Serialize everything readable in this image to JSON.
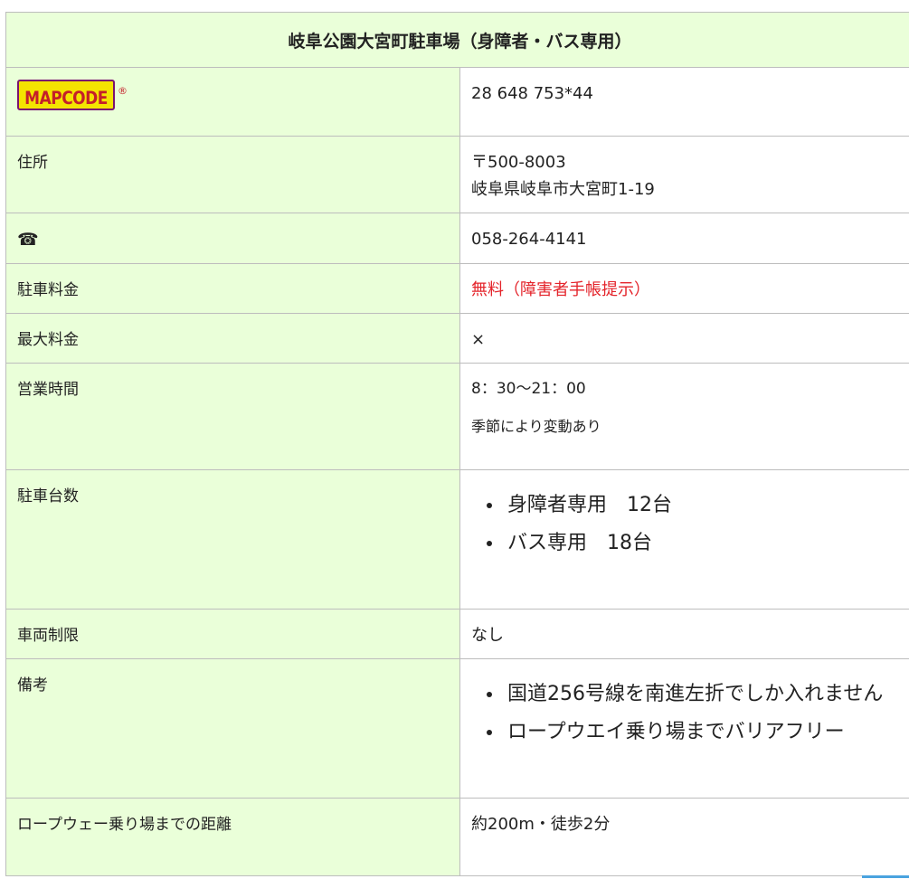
{
  "title": "岐阜公園大宮町駐車場（身障者・バス専用）",
  "mapcode": {
    "logo_text": "MAPCODE",
    "registered_mark": "®",
    "value": "28 648 753*44"
  },
  "address": {
    "label": "住所",
    "postal": "〒500-8003",
    "line": "岐阜県岐阜市大宮町1-19"
  },
  "phone": {
    "icon": "telephone-icon",
    "glyph": "☎",
    "value": "058-264-4141"
  },
  "fee": {
    "label": "駐車料金",
    "value": "無料（障害者手帳提示）",
    "color": "#e4242b"
  },
  "max_fee": {
    "label": "最大料金",
    "value": "×"
  },
  "hours": {
    "label": "営業時間",
    "value": "8：30〜21：00",
    "note": "季節により変動あり"
  },
  "spaces": {
    "label": "駐車台数",
    "items": [
      "身障者専用　12台",
      "バス専用　18台"
    ]
  },
  "vehicle_limit": {
    "label": "車両制限",
    "value": "なし"
  },
  "notes": {
    "label": "備考",
    "items": [
      "国道256号線を南進左折でしか入れません",
      "ロープウエイ乗り場までバリアフリー"
    ]
  },
  "ropeway_distance": {
    "label": "ロープウェー乗り場までの距離",
    "value": "約200m・徒歩2分"
  },
  "colors": {
    "label_bg": "#eaffd9",
    "border": "#bdbdbd",
    "logo_bg": "#f4e400",
    "logo_border": "#7a1470",
    "logo_text": "#c41f2a"
  }
}
